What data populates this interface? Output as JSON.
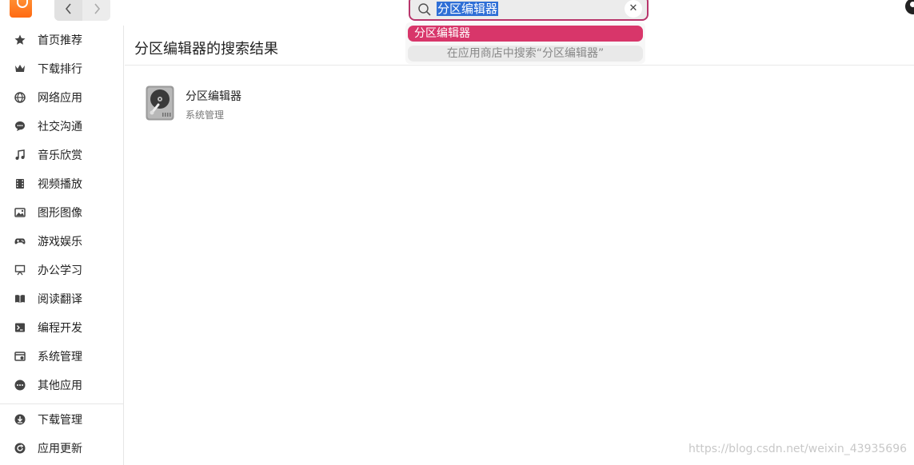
{
  "search": {
    "query": "分区编辑器",
    "clear_symbol": "✕"
  },
  "suggestions": {
    "first": "分区编辑器",
    "second": "在应用商店中搜索“分区编辑器”"
  },
  "sidebar": {
    "items": [
      {
        "label": "首页推荐",
        "icon": "star-icon"
      },
      {
        "label": "下载排行",
        "icon": "crown-icon"
      },
      {
        "label": "网络应用",
        "icon": "globe-icon"
      },
      {
        "label": "社交沟通",
        "icon": "chat-icon"
      },
      {
        "label": "音乐欣赏",
        "icon": "music-note-icon"
      },
      {
        "label": "视频播放",
        "icon": "film-icon"
      },
      {
        "label": "图形图像",
        "icon": "image-icon"
      },
      {
        "label": "游戏娱乐",
        "icon": "gamepad-icon"
      },
      {
        "label": "办公学习",
        "icon": "presentation-icon"
      },
      {
        "label": "阅读翻译",
        "icon": "book-icon"
      },
      {
        "label": "编程开发",
        "icon": "terminal-icon"
      },
      {
        "label": "系统管理",
        "icon": "system-window-icon"
      },
      {
        "label": "其他应用",
        "icon": "more-dots-icon"
      }
    ],
    "bottom_items": [
      {
        "label": "下载管理",
        "icon": "download-icon"
      },
      {
        "label": "应用更新",
        "icon": "refresh-icon"
      }
    ]
  },
  "main": {
    "title": "分区编辑器的搜索结果",
    "results": [
      {
        "name": "分区编辑器",
        "category": "系统管理",
        "icon": "hard-disk-icon"
      }
    ]
  },
  "watermark": "https://blog.csdn.net/weixin_43935696",
  "colors": {
    "accent": "#d8366a",
    "search_border": "#b8356b",
    "selection": "#2f6fd6"
  }
}
